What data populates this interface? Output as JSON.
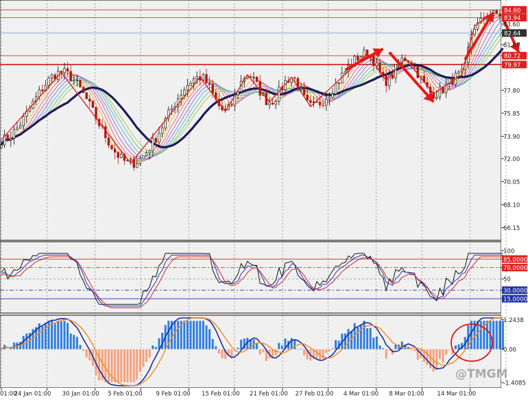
{
  "chart_data": {
    "type": "line",
    "instrument_view": "candlestick price chart with moving-average ribbon, oscillator and histogram sub-windows",
    "panels": [
      {
        "id": "price",
        "ylim": [
          65.2,
          85.2
        ],
        "y_ticks": [
          "84.60",
          "83.94",
          "83.60",
          "82.64",
          "81.65",
          "80.72",
          "79.97",
          "77.80",
          "75.85",
          "73.90",
          "72.00",
          "70.05",
          "68.10",
          "66.15"
        ],
        "price_labels": [
          {
            "text": "84.60",
            "value": 84.6,
            "bg": "#dd2020"
          },
          {
            "text": "83.94",
            "value": 83.94,
            "bg": "#dd2020"
          },
          {
            "text": "82.64",
            "value": 82.64,
            "bg": "#303030"
          },
          {
            "text": "80.72",
            "value": 80.72,
            "bg": "#dd2020"
          },
          {
            "text": "79.97",
            "value": 79.97,
            "bg": "#dd2020"
          }
        ],
        "hlines": [
          {
            "value": 84.6,
            "color": "#e03030"
          },
          {
            "value": 83.94,
            "color": "#e03030"
          },
          {
            "value": 82.64,
            "color": "#7f9fd8"
          },
          {
            "value": 80.72,
            "color": "#e03030"
          },
          {
            "value": 79.97,
            "color": "#d01818"
          }
        ],
        "zigzag": [
          {
            "i": 0,
            "v": 73.6
          },
          {
            "i": 19,
            "v": 79.3
          },
          {
            "i": 41,
            "v": 71.6
          },
          {
            "i": 63,
            "v": 78.9
          },
          {
            "i": 71,
            "v": 76.0
          },
          {
            "i": 78,
            "v": 79.1
          },
          {
            "i": 85,
            "v": 76.8
          },
          {
            "i": 92,
            "v": 78.9
          },
          {
            "i": 98,
            "v": 76.4
          },
          {
            "i": 116,
            "v": 80.9
          },
          {
            "i": 122,
            "v": 78.6
          },
          {
            "i": 128,
            "v": 80.5
          },
          {
            "i": 137,
            "v": 77.5
          },
          {
            "i": 146,
            "v": 79.1
          },
          {
            "i": 150,
            "v": 83.2
          },
          {
            "i": 155,
            "v": 84.2
          }
        ],
        "arrows": [
          {
            "from": [
              109,
              79.5
            ],
            "to": [
              121,
              81.3
            ]
          },
          {
            "from": [
              123,
              81.0
            ],
            "to": [
              137,
              76.8
            ]
          },
          {
            "from": [
              147,
              80.4
            ],
            "to": [
              156,
              84.4
            ]
          },
          {
            "from": [
              159,
              83.9
            ],
            "to": [
              164,
              81.0
            ]
          }
        ]
      },
      {
        "id": "oscillator",
        "ylim": [
          -8,
          112
        ],
        "y_ticks": [
          "100",
          "85.0000",
          "70.0000",
          "50",
          "30.0000",
          "15.0000"
        ],
        "levels": [
          {
            "value": 85,
            "label": "85.0000",
            "color": "#dd2020",
            "style": "solid"
          },
          {
            "value": 70,
            "label": "70.0000",
            "color": "#dd2020",
            "style": "dashdot"
          },
          {
            "value": 50,
            "label": "",
            "color": "#999999",
            "style": "dashed"
          },
          {
            "value": 30,
            "label": "30.0000",
            "color": "#2030a0",
            "style": "dashdot"
          },
          {
            "value": 15,
            "label": "15.0000",
            "color": "#2030a0",
            "style": "solid"
          }
        ],
        "series": [
          {
            "color": "#111111",
            "width": 1
          },
          {
            "color": "#2a30c8",
            "width": 1
          },
          {
            "color": "#d02828",
            "width": 1
          }
        ]
      },
      {
        "id": "histogram",
        "ylim": [
          -1.55,
          1.35
        ],
        "y_ticks": [
          "1.2438",
          "0.00",
          "-1.4085"
        ],
        "positive_color": "#2f7de0",
        "negative_color": "#f5a07a",
        "signal_color": "#1c2a9a",
        "slow_color": "#f08a1c",
        "annotation": {
          "shape": "ellipse",
          "color": "#dd1818"
        }
      }
    ],
    "x_ticks": [
      {
        "label": "01:00",
        "i": 0
      },
      {
        "label": "24 Jan 01:00",
        "i": 19
      },
      {
        "label": "30 Jan 01:00",
        "i": 39
      },
      {
        "label": "5 Feb 01:00",
        "i": 58
      },
      {
        "label": "9 Feb 01:00",
        "i": 78
      },
      {
        "label": "15 Feb 01:00",
        "i": 97
      },
      {
        "label": "21 Feb 01:00",
        "i": 117
      },
      {
        "label": "27 Feb 01:00",
        "i": 136
      },
      {
        "label": "4 Mar 01:00",
        "i": 156
      },
      {
        "label": "8 Mar 01:00",
        "i": 175
      },
      {
        "label": "14 Mar 01:00",
        "i": 195
      },
      {
        "label": "",
        "i": 210
      }
    ],
    "bars_count": 160,
    "watermark": "@TMGM",
    "grid": false,
    "legend": "none"
  }
}
